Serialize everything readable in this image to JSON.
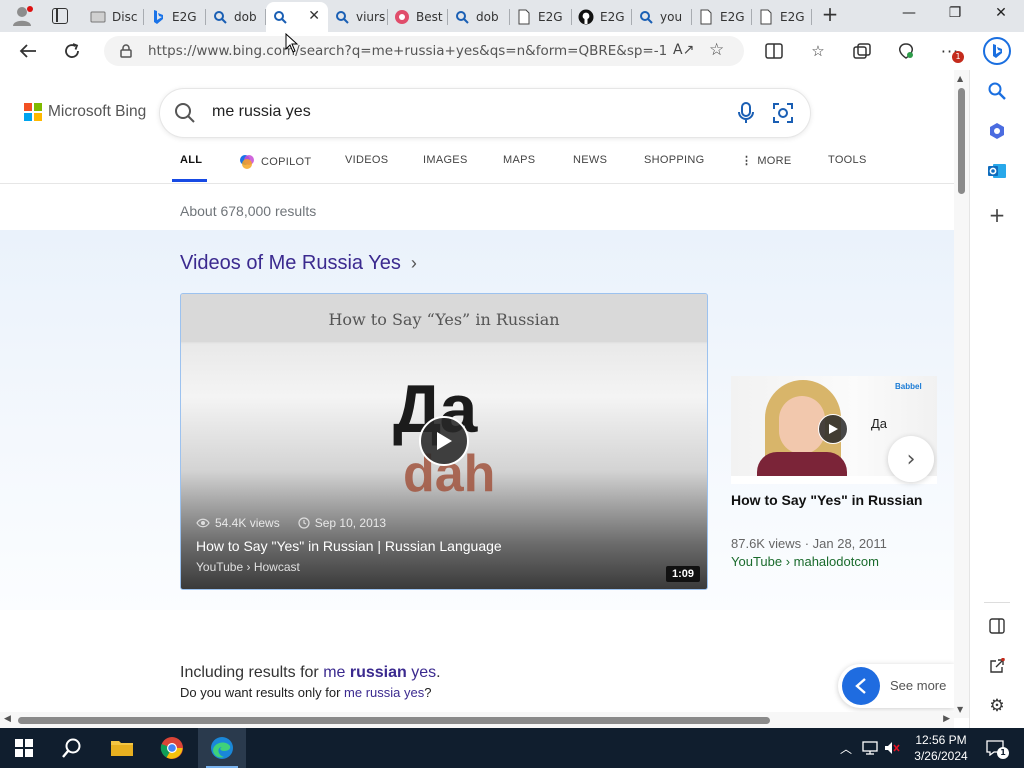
{
  "browser": {
    "tabs": [
      {
        "label": "Disc",
        "icon": "page-icon"
      },
      {
        "label": "E2G",
        "icon": "bing-icon"
      },
      {
        "label": "dob",
        "icon": "search-icon"
      },
      {
        "label": "",
        "icon": "search-icon",
        "active": true
      },
      {
        "label": "viurs",
        "icon": "search-icon"
      },
      {
        "label": "Best",
        "icon": "app-icon"
      },
      {
        "label": "dob",
        "icon": "search-icon"
      },
      {
        "label": "E2G",
        "icon": "doc-icon"
      },
      {
        "label": "E2G",
        "icon": "github-icon"
      },
      {
        "label": "you",
        "icon": "search-icon"
      },
      {
        "label": "E2G",
        "icon": "doc-icon"
      },
      {
        "label": "E2G",
        "icon": "doc-icon"
      }
    ],
    "url": "https://www.bing.com/search?q=me+russia+yes&qs=n&form=QBRE&sp=-1&g...",
    "notification_badge": "1",
    "colors": {
      "accent": "#1f6ce0",
      "link": "#3b2a8f",
      "cite": "#1a6b2c",
      "underline": "#174ae4"
    }
  },
  "bing": {
    "brand": "Microsoft Bing",
    "query": "me russia yes",
    "scopes": [
      {
        "label": "ALL",
        "active": true
      },
      {
        "label": "COPILOT"
      },
      {
        "label": "VIDEOS"
      },
      {
        "label": "IMAGES"
      },
      {
        "label": "MAPS"
      },
      {
        "label": "NEWS"
      },
      {
        "label": "SHOPPING"
      },
      {
        "label": "MORE"
      },
      {
        "label": "TOOLS"
      }
    ],
    "result_count": "About 678,000 results",
    "videos": {
      "heading": "Videos of Me Russia Yes",
      "main": {
        "banner": "How to Say “Yes” in Russian",
        "thumb_word": "Да",
        "thumb_translit": "dah",
        "views": "54.4K views",
        "date": "Sep 10, 2013",
        "title": "How to Say \"Yes\" in Russian | Russian Language",
        "source": "YouTube › Howcast",
        "duration": "1:09"
      },
      "second": {
        "thumb_word": "Да",
        "thumb_brand": "Babbel",
        "title": "How to Say \"Yes\" in Russian",
        "meta": "87.6K views · Jan 28, 2011",
        "source": "YouTube › mahalodotcom"
      }
    },
    "including": {
      "prefix": "Including results for ",
      "term1": "me ",
      "term2": "russian",
      "term3": " yes",
      "suffix": ".",
      "alt_prefix": "Do you want results only for ",
      "alt_link": "me russia yes",
      "alt_suffix": "?"
    },
    "see_more": "See more"
  },
  "taskbar": {
    "time": "12:56 PM",
    "date": "3/26/2024",
    "notification_count": "1"
  }
}
